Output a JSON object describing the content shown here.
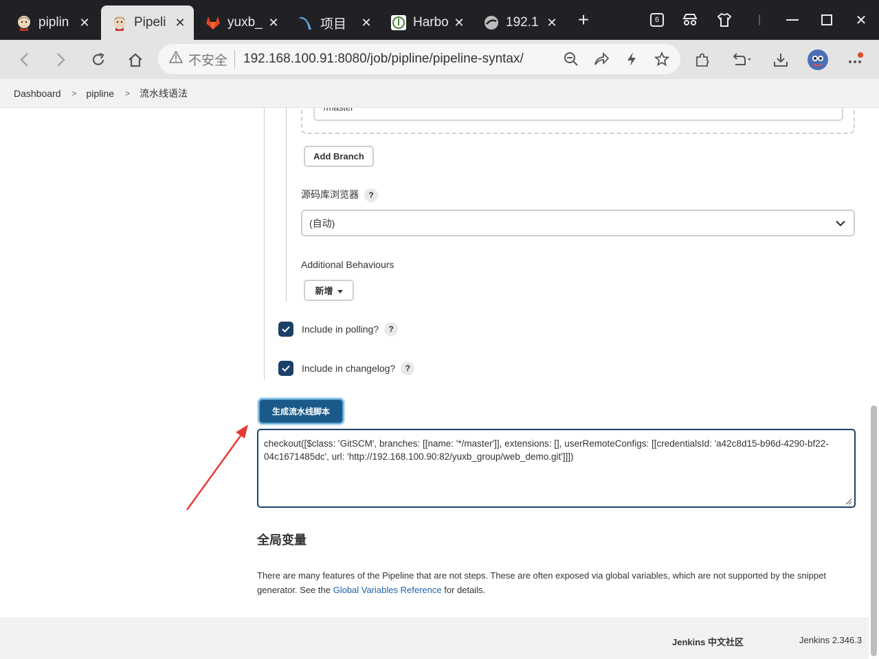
{
  "browser": {
    "tabs": [
      {
        "title": "piplin",
        "icon": "jenkins-icon",
        "active": false
      },
      {
        "title": "Pipeli",
        "icon": "jenkins-icon",
        "active": true
      },
      {
        "title": "yuxb_",
        "icon": "gitlab-icon",
        "active": false
      },
      {
        "title": "项目",
        "icon": "harbor-wave-icon",
        "active": false
      },
      {
        "title": "Harbo",
        "icon": "harbor-icon",
        "active": false
      },
      {
        "title": "192.1",
        "icon": "globe-icon",
        "active": false
      }
    ],
    "tab_count_badge": "6",
    "address": {
      "security_label": "不安全",
      "url": "192.168.100.91:8080/job/pipline/pipeline-syntax/"
    }
  },
  "breadcrumb": [
    "Dashboard",
    "pipline",
    "流水线语法"
  ],
  "form": {
    "branch_value": "*/master",
    "add_branch_label": "Add Branch",
    "repo_browser_label": "源码库浏览器",
    "repo_browser_value": "(自动)",
    "additional_behaviours_label": "Additional Behaviours",
    "add_behaviour_label": "新增",
    "include_polling_label": "Include in polling?",
    "include_polling_checked": true,
    "include_changelog_label": "Include in changelog?",
    "include_changelog_checked": true,
    "help_text": "?"
  },
  "generate_button_label": "生成流水线脚本",
  "snippet_output": "checkout([$class: 'GitSCM', branches: [[name: '*/master']], extensions: [], userRemoteConfigs: [[credentialsId: 'a42c8d15-b96d-4290-bf22-04c1671485dc', url: 'http://192.168.100.90:82/yuxb_group/web_demo.git']]])",
  "global_vars": {
    "heading": "全局变量",
    "text_before": "There are many features of the Pipeline that are not steps. These are often exposed via global variables, which are not supported by the snippet generator. See the ",
    "link_text": "Global Variables Reference",
    "text_after": " for details."
  },
  "footer": {
    "community": "Jenkins 中文社区",
    "version": "Jenkins 2.346.3"
  },
  "colors": {
    "checkbox": "#1c3f68",
    "primary_button": "#1a5a8a",
    "link": "#1f62a8",
    "annotation_arrow": "#e53935"
  }
}
